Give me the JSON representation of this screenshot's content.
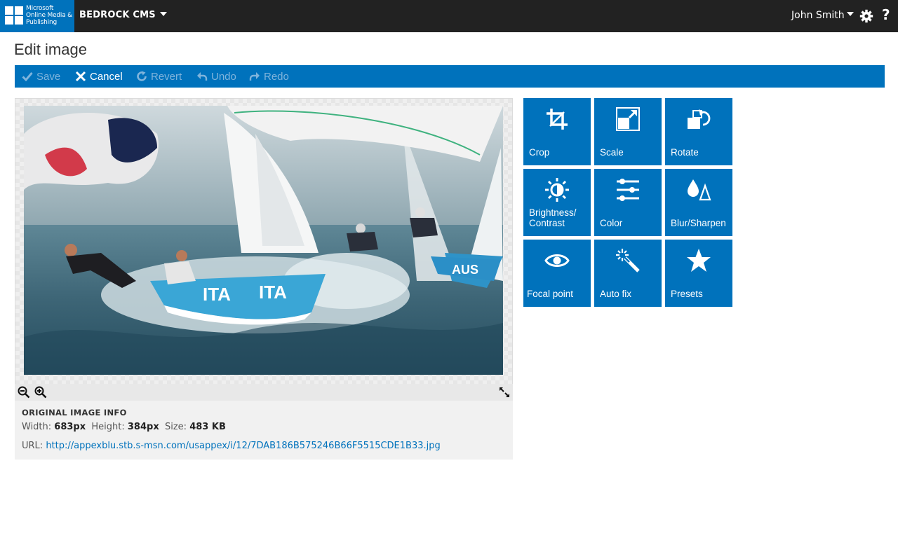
{
  "header": {
    "logo_text": "Microsoft Online Media & Publishing",
    "app_name": "BEDROCK CMS",
    "user_name": "John Smith"
  },
  "page": {
    "title": "Edit image"
  },
  "toolbar": {
    "save": "Save",
    "cancel": "Cancel",
    "revert": "Revert",
    "undo": "Undo",
    "redo": "Redo"
  },
  "image_info": {
    "heading": "ORIGINAL IMAGE INFO",
    "width_label": "Width:",
    "width_value": "683px",
    "height_label": "Height:",
    "height_value": "384px",
    "size_label": "Size:",
    "size_value": "483 KB",
    "url_label": "URL:",
    "url_value": "http://appexblu.stb.s-msn.com/usappex/i/12/7DAB186B575246B66F5515CDE1B33.jpg"
  },
  "photo": {
    "hull_text_1": "ITA",
    "hull_text_2": "ITA",
    "hull_text_3": "AUS"
  },
  "tools": [
    {
      "label": "Crop",
      "icon": "crop-icon"
    },
    {
      "label": "Scale",
      "icon": "scale-icon"
    },
    {
      "label": "Rotate",
      "icon": "rotate-icon"
    },
    {
      "label": "Brightness/ Contrast",
      "icon": "brightness-icon"
    },
    {
      "label": "Color",
      "icon": "color-sliders-icon"
    },
    {
      "label": "Blur/Sharpen",
      "icon": "blur-sharpen-icon"
    },
    {
      "label": "Focal point",
      "icon": "eye-icon"
    },
    {
      "label": "Auto fix",
      "icon": "magic-wand-icon"
    },
    {
      "label": "Presets",
      "icon": "star-icon"
    }
  ],
  "colors": {
    "accent": "#0072bc",
    "topbar": "#222222",
    "disabled_text": "#7fb4dc"
  }
}
